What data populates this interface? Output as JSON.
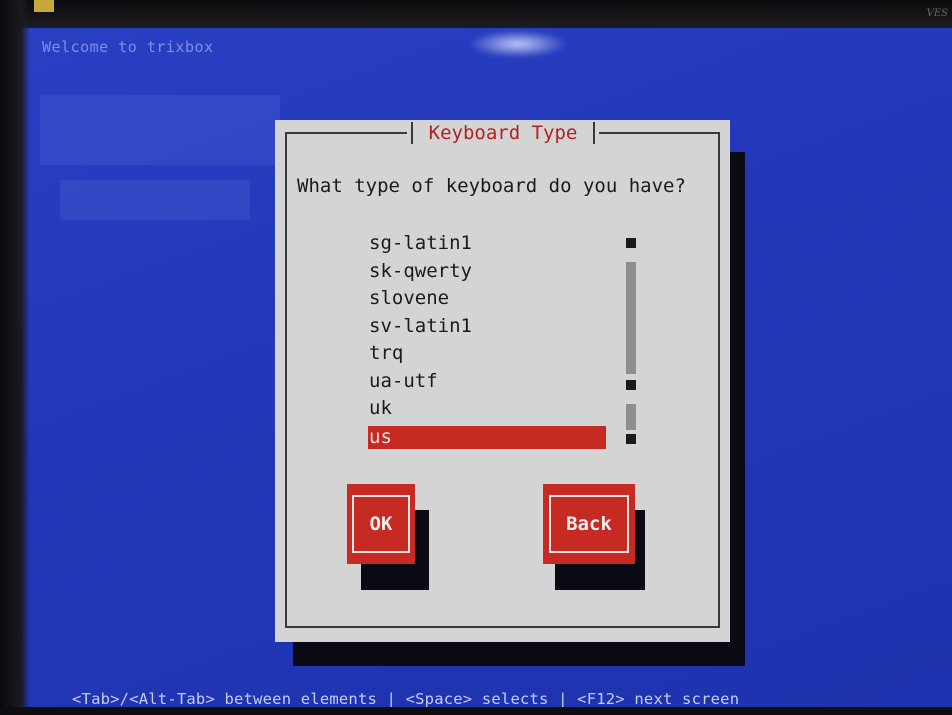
{
  "screen": {
    "welcome_text": "Welcome to trixbox",
    "vendor_mark": "VES",
    "background_color": "#2238b8"
  },
  "dialog": {
    "title": "Keyboard Type",
    "prompt": "What type of keyboard do you have?",
    "keyboard_options": [
      {
        "label": "sg-latin1",
        "selected": false
      },
      {
        "label": "sk-qwerty",
        "selected": false
      },
      {
        "label": "slovene",
        "selected": false
      },
      {
        "label": "sv-latin1",
        "selected": false
      },
      {
        "label": "trq",
        "selected": false
      },
      {
        "label": "ua-utf",
        "selected": false
      },
      {
        "label": "uk",
        "selected": false
      },
      {
        "label": "us",
        "selected": true
      }
    ],
    "buttons": {
      "ok_label": "OK",
      "back_label": "Back"
    },
    "colors": {
      "dialog_bg": "#d4d4d4",
      "title_text": "#b42020",
      "selection_bg": "#c62a22",
      "button_bg": "#c62a22"
    }
  },
  "footer": {
    "help_text": "<Tab>/<Alt-Tab> between elements  | <Space> selects | <F12> next screen"
  }
}
